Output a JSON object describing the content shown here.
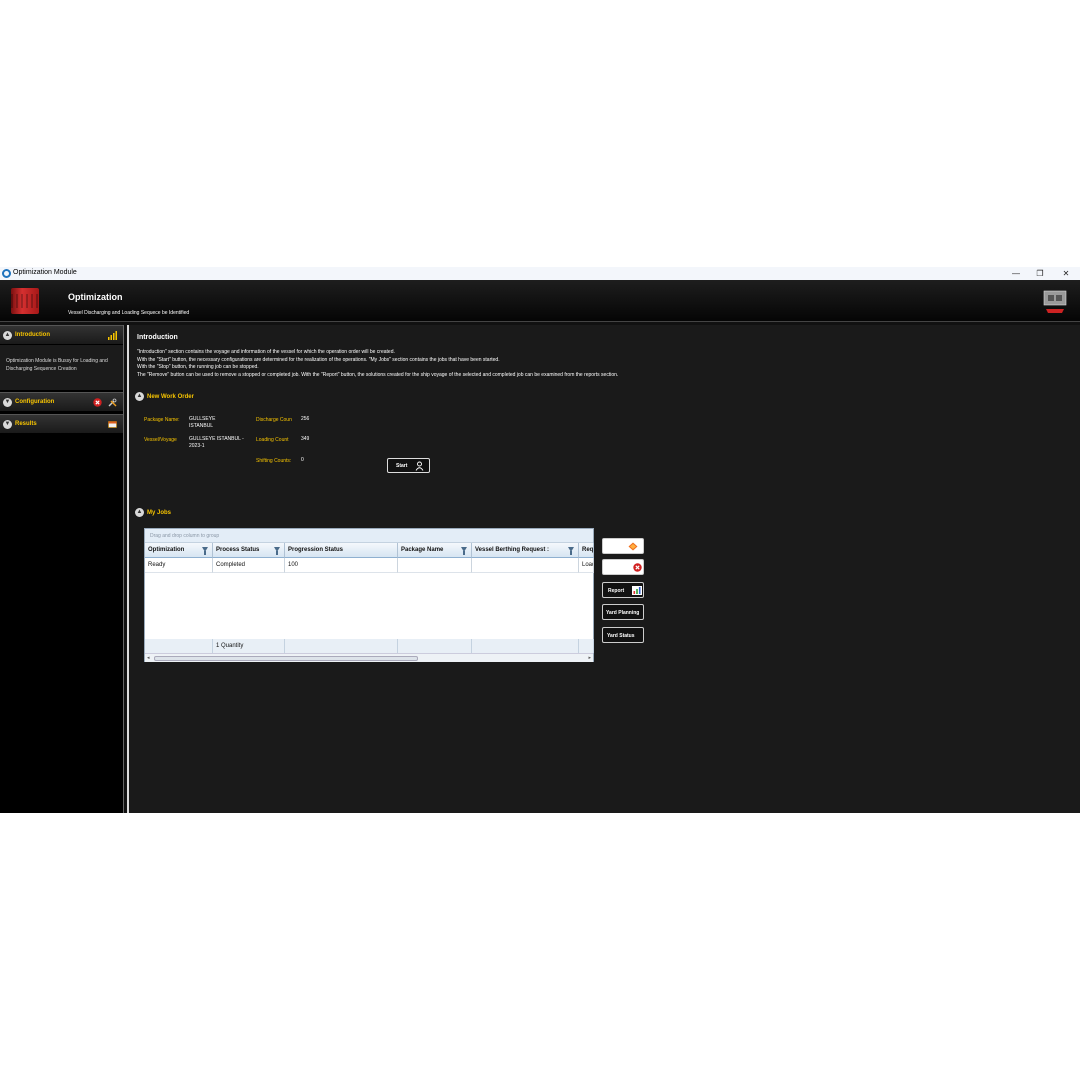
{
  "window": {
    "title": "Optimization Module",
    "controls": [
      "—",
      "❐",
      "✕"
    ]
  },
  "header": {
    "title": "Optimization",
    "subtitle": "Vessel Discharging and Loading Sequece be Identified"
  },
  "sidebar": {
    "introduction": {
      "label": "Introduction",
      "body": "Optimization Module is Bussy for Loading and Discharging Sequence Creation"
    },
    "configuration": {
      "label": "Configuration"
    },
    "results": {
      "label": "Results"
    }
  },
  "intro": {
    "title": "Introduction",
    "lines": [
      "\"Introduction\" section contains the voyage and information of the vessel for which the operation order will be created.",
      "With the \"Start\" button, the necessary configurations are determined for the realization of the operations. \"My Jobs\" section contains the jobs that have been started.",
      "With the \"Stop\" button, the running job can be stopped.",
      "The \"Remove\" button can be used to remove a stopped or completed job. With the \"Report\" button, the solutions created for the ship voyage of the selected and completed job can be examined from the reports section."
    ]
  },
  "new_work_order": {
    "title": "New Work Order",
    "package_name_label": "Package Name:",
    "package_name_value": "GULLSEYE ISTANBUL",
    "vessel_voyage_label": "Vessel/Voyage",
    "vessel_voyage_value": "GULLSEYE ISTANBUL - 2023-1",
    "discharge_label": "Discharge Coun",
    "discharge_value": "256",
    "loading_label": "Loading Count",
    "loading_value": "349",
    "shifting_label": "Shifting Counts:",
    "shifting_value": "0",
    "start_label": "Start"
  },
  "my_jobs": {
    "title": "My Jobs",
    "group_hint": "Drag and drop column to group",
    "columns": [
      "Optimization",
      "Process Status",
      "Progression Status",
      "Package Name",
      "Vessel Berthing Request :",
      "Req"
    ],
    "rows": [
      [
        "Ready",
        "Completed",
        "100",
        "",
        "",
        "Load"
      ]
    ],
    "footer": [
      "",
      "1 Quantity",
      "",
      "",
      "",
      ""
    ],
    "buttons": {
      "report": "Report",
      "yard_planning": "Yard Planning",
      "yard_status": "Yard Status"
    }
  },
  "colors": {
    "accent": "#f7c400",
    "background": "#1a1a1a",
    "container_red": "#d53030"
  }
}
